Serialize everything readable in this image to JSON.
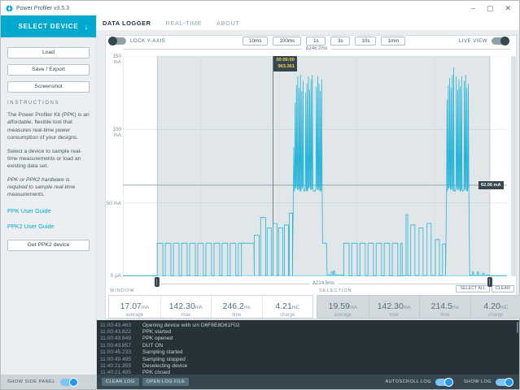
{
  "window": {
    "title": "Power Profiler v3.5.3",
    "controls": {
      "minimize": "–",
      "maximize": "▢",
      "close": "✕"
    }
  },
  "sidebar": {
    "select_device": "SELECT DEVICE",
    "buttons": {
      "load": "Load",
      "save_export": "Save / Export",
      "screenshot": "Screenshot"
    },
    "instructions_title": "INSTRUCTIONS",
    "paragraph1": "The Power Profiler Kit (PPK) is an affordable, flexible tool that measures real-time power consumption of your designs.",
    "paragraph2": "Select a device to sample real-time measurements or load an existing data set.",
    "paragraph3": "PPK or PPK2 hardware is required to sample real-time measurements.",
    "link_ppk": "PPK User Guide",
    "link_ppk2": "PPK2 User Guide",
    "get_ppk2": "Get PPK2 device"
  },
  "tabs": {
    "data_logger": "DATA LOGGER",
    "real_time": "REAL-TIME",
    "about": "ABOUT"
  },
  "toolbar": {
    "lock_y_axis": "LOCK Y-AXIS",
    "ranges": [
      "10ms",
      "100ms",
      "1s",
      "3s",
      "10s",
      "1min"
    ],
    "live_view": "LIVE VIEW"
  },
  "chart": {
    "window_delta": "Δ246.2ms",
    "selection_delta": "Δ214.5ms",
    "y_ticks": {
      "t150": "150 mA",
      "t100": "100 mA",
      "t50": "50 mA",
      "t0": "0 µA"
    },
    "cursor_tooltip": {
      "line1": "00:00:00",
      "line2": "963.261"
    },
    "marker_label": "62.06 mA",
    "select_all": "SELECT ALL",
    "clear": "CLEAR"
  },
  "stats": {
    "window_label": "WINDOW",
    "selection_label": "SELECTION",
    "window": [
      {
        "value": "17.07",
        "unit": "mA",
        "label": "average"
      },
      {
        "value": "142.30",
        "unit": "mA",
        "label": "max"
      },
      {
        "value": "246.2",
        "unit": "ms",
        "label": "time"
      },
      {
        "value": "4.21",
        "unit": "mC",
        "label": "charge"
      }
    ],
    "selection": [
      {
        "value": "19.59",
        "unit": "mA",
        "label": "average"
      },
      {
        "value": "142.30",
        "unit": "mA",
        "label": "max"
      },
      {
        "value": "214.5",
        "unit": "ms",
        "label": "time"
      },
      {
        "value": "4.20",
        "unit": "mC",
        "label": "charge"
      }
    ]
  },
  "log": {
    "entries": [
      {
        "time": "11:00:43.463",
        "message": "Opening device with s/n D6F8E8D61F02"
      },
      {
        "time": "11:00:43.822",
        "message": "PPK started"
      },
      {
        "time": "11:00:43.849",
        "message": "PPK opened"
      },
      {
        "time": "11:00:43.857",
        "message": "DUT ON"
      },
      {
        "time": "11:00:45.233",
        "message": "Sampling started"
      },
      {
        "time": "11:00:49.495",
        "message": "Sampling stopped"
      },
      {
        "time": "11:40:21.355",
        "message": "Deselecting device"
      },
      {
        "time": "11:40:21.485",
        "message": "PPK closed"
      }
    ],
    "clear_log": "CLEAR LOG",
    "open_log_file": "OPEN LOG FILE",
    "autoscroll": "AUTOSCROLL LOG",
    "show_log": "SHOW LOG",
    "show_side_panel": "SHOW SIDE PANEL"
  },
  "colors": {
    "accent_teal": "#00a9ce",
    "toggle_blue": "#2196f3",
    "chart_line": "#26b4d8",
    "log_background": "#263238",
    "tooltip_background": "#37474f"
  },
  "chart_data": {
    "type": "line",
    "x_unit": "ms",
    "y_unit": "mA",
    "x_range_ms": [
      0,
      246.2
    ],
    "y_range_mA": [
      0,
      150
    ],
    "y_gridlines_mA": [
      50,
      100,
      150
    ],
    "x_gridlines_ms": [
      50,
      100,
      150,
      200
    ],
    "selection_ms": [
      22,
      235.2
    ],
    "cursor_ms": 96.2,
    "marker_mA": 62.06,
    "window_stats": {
      "average_mA": 17.07,
      "max_mA": 142.3,
      "time_ms": 246.2,
      "charge_mC": 4.21
    },
    "selection_stats": {
      "average_mA": 19.59,
      "max_mA": 142.3,
      "time_ms": 214.5,
      "charge_mC": 4.2
    },
    "segments": [
      {
        "type": "flat",
        "t0": 0,
        "t1": 22,
        "mA": 0.2
      },
      {
        "type": "pulses",
        "t0": 22,
        "t1": 76,
        "period": 5.2,
        "high": 3.6,
        "mA": 22.5,
        "low": 0.2
      },
      {
        "type": "flat",
        "t0": 76,
        "t1": 84,
        "mA": 22.5
      },
      {
        "type": "steps",
        "lowmA": 0.6,
        "items": [
          [
            84.2,
            87.3,
            28
          ],
          [
            88.3,
            91.5,
            40
          ],
          [
            92.5,
            95.1,
            33
          ],
          [
            96.2,
            98.8,
            36
          ],
          [
            99.8,
            102.5,
            33
          ],
          [
            103.5,
            106.1,
            35
          ],
          [
            106.6,
            108.7,
            43
          ]
        ]
      },
      {
        "type": "burst",
        "t0": 109.3,
        "t1": 128,
        "base": 60,
        "peaks": [
          88,
          118,
          130,
          136,
          128,
          137,
          126,
          133,
          136,
          125,
          131,
          136,
          127,
          134,
          137,
          126,
          135,
          129,
          136,
          131,
          126,
          134
        ],
        "dips": [
          [
            115.8,
            116.9
          ],
          [
            122.0,
            123.2
          ]
        ],
        "dipmA": 58
      },
      {
        "type": "flat",
        "t0": 128,
        "t1": 130.5,
        "mA": 22.5
      },
      {
        "type": "steps",
        "lowmA": 0.7,
        "items": [
          [
            130.9,
            133.0,
            0.9
          ],
          [
            133.5,
            134.5,
            3
          ],
          [
            135.0,
            136.0,
            3.5
          ],
          [
            136.5,
            141.0,
            0.9
          ]
        ]
      },
      {
        "type": "pulses",
        "t0": 141.5,
        "t1": 179,
        "period": 5.2,
        "high": 3.5,
        "mA": 22.5,
        "low": 0.2
      },
      {
        "type": "steps",
        "lowmA": 0.5,
        "items": [
          [
            181.5,
            182.6,
            42
          ],
          [
            184.5,
            187.2,
            35
          ],
          [
            189.8,
            192.4,
            33
          ],
          [
            195.0,
            197.6,
            36
          ],
          [
            200.3,
            202.9,
            25
          ],
          [
            204.9,
            206.8,
            22
          ]
        ]
      },
      {
        "type": "burst",
        "t0": 207.5,
        "t1": 222,
        "base": 60,
        "peaks": [
          120,
          130,
          135,
          128,
          137,
          142,
          132,
          136,
          127,
          134,
          129,
          136,
          125,
          133,
          137,
          128,
          131
        ],
        "dips": [
          [
            212.2,
            213.3
          ],
          [
            217.3,
            218.4
          ]
        ],
        "dipmA": 58
      },
      {
        "type": "steps",
        "lowmA": 0.6,
        "items": [
          [
            222.3,
            223.3,
            0.9
          ],
          [
            224.0,
            224.8,
            3
          ],
          [
            227.2,
            228.0,
            3
          ],
          [
            230.8,
            231.5,
            2.2
          ],
          [
            233.5,
            234.8,
            0.9
          ]
        ]
      },
      {
        "type": "flat",
        "t0": 235.2,
        "t1": 246.2,
        "mA": 0.2
      }
    ]
  }
}
